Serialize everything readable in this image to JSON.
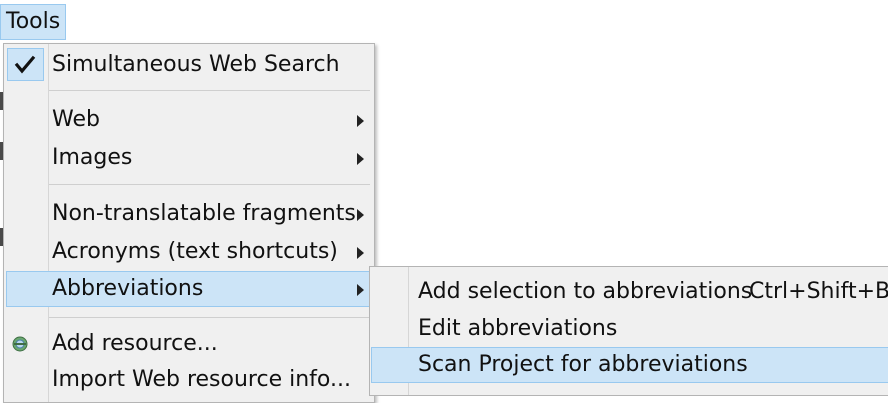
{
  "menubar": {
    "title": "Tools"
  },
  "menu": {
    "items": [
      {
        "label": "Simultaneous Web Search",
        "checked": true,
        "icon": "check-icon"
      },
      {
        "label": "Web",
        "submenu": true
      },
      {
        "label": "Images",
        "submenu": true
      },
      {
        "label": "Non-translatable fragments",
        "submenu": true
      },
      {
        "label": "Acronyms (text shortcuts)",
        "submenu": true
      },
      {
        "label": "Abbreviations",
        "submenu": true,
        "highlighted": true
      },
      {
        "label": "Add resource...",
        "icon": "resource-icon"
      },
      {
        "label": "Import Web resource info..."
      }
    ]
  },
  "submenu": {
    "items": [
      {
        "label": "Add selection to abbreviations",
        "shortcut": "Ctrl+Shift+B"
      },
      {
        "label": "Edit abbreviations"
      },
      {
        "label": "Scan Project for abbreviations",
        "highlighted": true
      }
    ]
  },
  "colors": {
    "highlight": "#cce4f7",
    "highlight_border": "#99c9ef",
    "menu_bg": "#f0f0f0"
  }
}
